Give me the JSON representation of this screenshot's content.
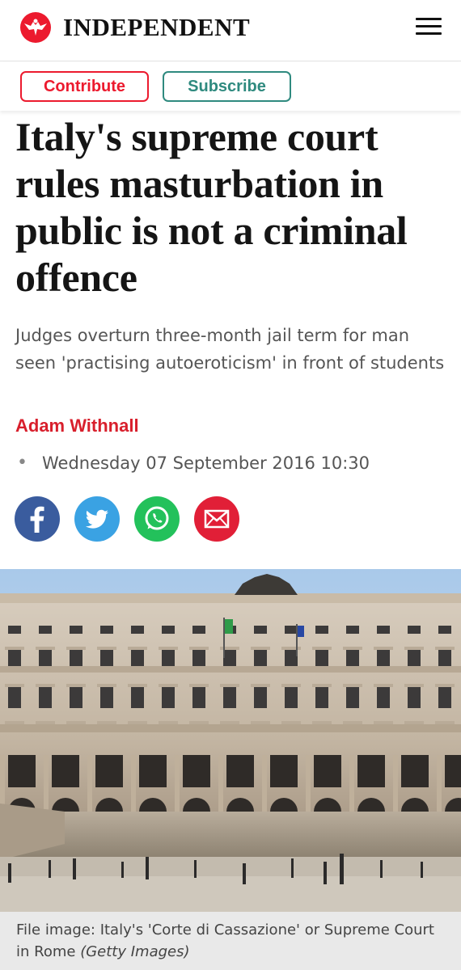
{
  "header": {
    "brand": "INDEPENDENT",
    "brand_color": "#ec1a2e",
    "logo_icon": "eagle-logo-icon",
    "menu_icon": "hamburger-menu-icon"
  },
  "actions": {
    "contribute_label": "Contribute",
    "subscribe_label": "Subscribe",
    "contribute_color": "#ec1a2e",
    "subscribe_color": "#2f8a7f"
  },
  "article": {
    "headline": "Italy's supreme court rules masturbation in public is not a criminal offence",
    "standfirst": "Judges overturn three-month jail term for man seen 'practising autoeroticism' in front of students",
    "author": "Adam Withnall",
    "date": "Wednesday 07 September 2016 10:30"
  },
  "share": [
    {
      "name": "facebook",
      "icon": "facebook-icon",
      "color": "#3a5c9e"
    },
    {
      "name": "twitter",
      "icon": "twitter-icon",
      "color": "#3aa2e3"
    },
    {
      "name": "whatsapp",
      "icon": "whatsapp-icon",
      "color": "#23c15b"
    },
    {
      "name": "email",
      "icon": "email-icon",
      "color": "#e11f37"
    }
  ],
  "image": {
    "caption": "File image: Italy's 'Corte di Cassazione' or Supreme Court in Rome",
    "credit": "(Getty Images)"
  }
}
